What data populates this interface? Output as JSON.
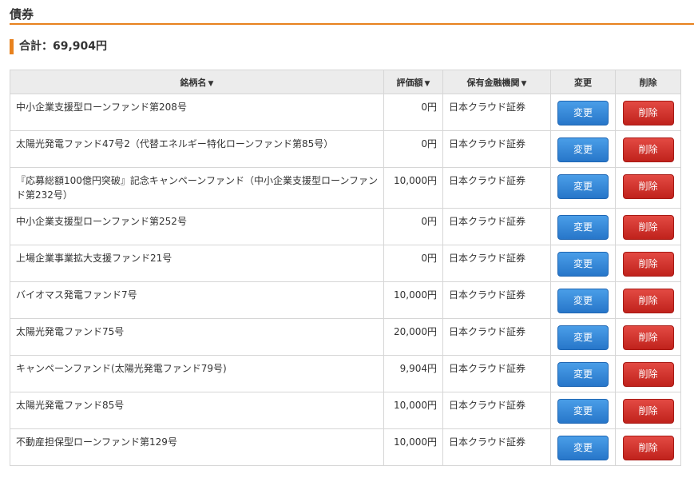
{
  "header": {
    "title": "債券"
  },
  "summary": {
    "total_label": "合計：69,904円"
  },
  "table": {
    "columns": {
      "name": "銘柄名",
      "valuation": "評価額",
      "institution": "保有金融機関",
      "edit": "変更",
      "delete": "削除"
    },
    "sort_glyph": "▼",
    "rows": [
      {
        "name": "中小企業支援型ローンファンド第208号",
        "amount": "0円",
        "institution": "日本クラウド証券",
        "edit": "変更",
        "delete": "削除"
      },
      {
        "name": "太陽光発電ファンド47号2（代替エネルギー特化ローンファンド第85号）",
        "amount": "0円",
        "institution": "日本クラウド証券",
        "edit": "変更",
        "delete": "削除"
      },
      {
        "name": "『応募総額100億円突破』記念キャンペーンファンド（中小企業支援型ローンファンド第232号）",
        "amount": "10,000円",
        "institution": "日本クラウド証券",
        "edit": "変更",
        "delete": "削除"
      },
      {
        "name": "中小企業支援型ローンファンド第252号",
        "amount": "0円",
        "institution": "日本クラウド証券",
        "edit": "変更",
        "delete": "削除"
      },
      {
        "name": "上場企業事業拡大支援ファンド21号",
        "amount": "0円",
        "institution": "日本クラウド証券",
        "edit": "変更",
        "delete": "削除"
      },
      {
        "name": "バイオマス発電ファンド7号",
        "amount": "10,000円",
        "institution": "日本クラウド証券",
        "edit": "変更",
        "delete": "削除"
      },
      {
        "name": "太陽光発電ファンド75号",
        "amount": "20,000円",
        "institution": "日本クラウド証券",
        "edit": "変更",
        "delete": "削除"
      },
      {
        "name": "キャンペーンファンド(太陽光発電ファンド79号)",
        "amount": "9,904円",
        "institution": "日本クラウド証券",
        "edit": "変更",
        "delete": "削除"
      },
      {
        "name": "太陽光発電ファンド85号",
        "amount": "10,000円",
        "institution": "日本クラウド証券",
        "edit": "変更",
        "delete": "削除"
      },
      {
        "name": "不動産担保型ローンファンド第129号",
        "amount": "10,000円",
        "institution": "日本クラウド証券",
        "edit": "変更",
        "delete": "削除"
      }
    ]
  },
  "colors": {
    "accent": "#e8821e",
    "edit_button": "#2f80d1",
    "delete_button": "#d12f28",
    "header_bg": "#ececec"
  }
}
